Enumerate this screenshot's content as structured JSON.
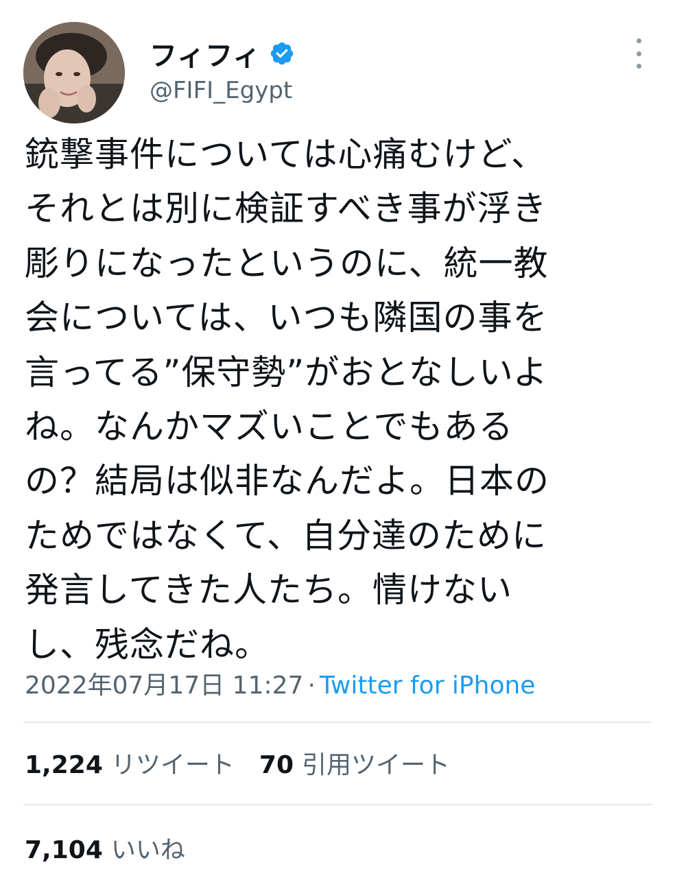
{
  "author": {
    "display_name": "フィフィ",
    "handle": "@FIFI_Egypt",
    "verified": true
  },
  "tweet": {
    "lines": [
      "銃撃事件については心痛むけど、",
      "それとは別に検証すべき事が浮き",
      "彫りになったというのに、統一教",
      "会については、いつも隣国の事を",
      "言ってる”保守勢”がおとなしいよ",
      "ね。なんかマズいことでもある",
      "の？結局は似非なんだよ。日本の",
      "ためではなくて、自分達のために",
      "発言してきた人たち。情けない",
      "し、残念だね。"
    ],
    "timestamp": "2022年07月17日 11:27",
    "separator": "·",
    "source": "Twitter for iPhone"
  },
  "stats": {
    "retweets": {
      "count": "1,224",
      "label": "リツイート"
    },
    "quotes": {
      "count": "70",
      "label": "引用ツイート"
    },
    "likes": {
      "count": "7,104",
      "label": "いいね"
    }
  },
  "icons": {
    "verified": "verified-badge-icon",
    "more": "more-options-icon"
  },
  "colors": {
    "text_primary": "#0f1419",
    "text_secondary": "#536471",
    "accent": "#1d9bf0"
  }
}
